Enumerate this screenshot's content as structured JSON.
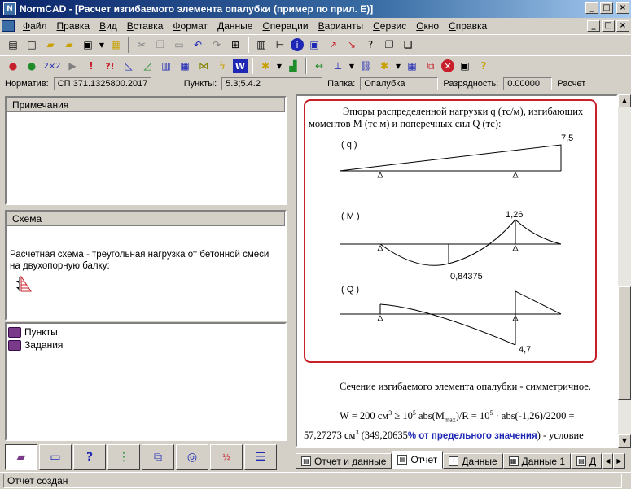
{
  "window": {
    "app_name": "NormCAD",
    "doc_title": "[Расчет изгибаемого элемента опалубки (пример по прил. Е)]",
    "min_label": "_",
    "max_label": "□",
    "close_label": "×"
  },
  "menu": [
    "Файл",
    "Правка",
    "Вид",
    "Вставка",
    "Формат",
    "Данные",
    "Операции",
    "Варианты",
    "Сервис",
    "Окно",
    "Справка"
  ],
  "infobar": {
    "norm_label": "Норматив:",
    "norm_value": "СП 371.1325800.2017",
    "points_label": "Пункты:",
    "points_value": "5.3;5.4.2",
    "folder_label": "Папка:",
    "folder_value": "Опалубка",
    "digits_label": "Разрядность:",
    "digits_value": "0.00000",
    "calc_label": "Расчет"
  },
  "left": {
    "notes_title": "Примечания",
    "scheme_title": "Схема",
    "scheme_text": "Расчетная схема - треугольная нагрузка от бетонной смеси на двухопорную балку:",
    "tree": [
      "Пункты",
      "Задания"
    ]
  },
  "report": {
    "caption": "Эпюры распределенной нагрузки q (тс/м), изгибающих моментов M (тс м) и поперечных сил Q (тс):",
    "diag_q_label": "( q )",
    "diag_q_value": "7,5",
    "diag_m_label": "( M )",
    "diag_m_max": "1,26",
    "diag_m_min": "0,84375",
    "diag_q2_label": "( Q )",
    "diag_q2_value": "4,7",
    "section_text": "Сечение изгибаемого элемента опалубки - симметричное.",
    "formula": {
      "w_prefix": "W = 200 см",
      "w_exp": "3",
      "ge": " ≥ 10",
      "exp5a": "5",
      "abs_part": " abs(M",
      "max_sub": "max",
      "r_part": ")/R = 10",
      "exp5b": "5",
      "calc_part": " · abs(-1,26)/2200 = 57,27273 см",
      "exp3": "3",
      "paren_open": " (349,20635",
      "percent_text": "% от предельного значения",
      "tail": ") - условие выполнено ."
    }
  },
  "right_tabs": [
    "Отчет и данные",
    "Отчет",
    "Данные",
    "Данные 1",
    "Д"
  ],
  "status": "Отчет создан"
}
